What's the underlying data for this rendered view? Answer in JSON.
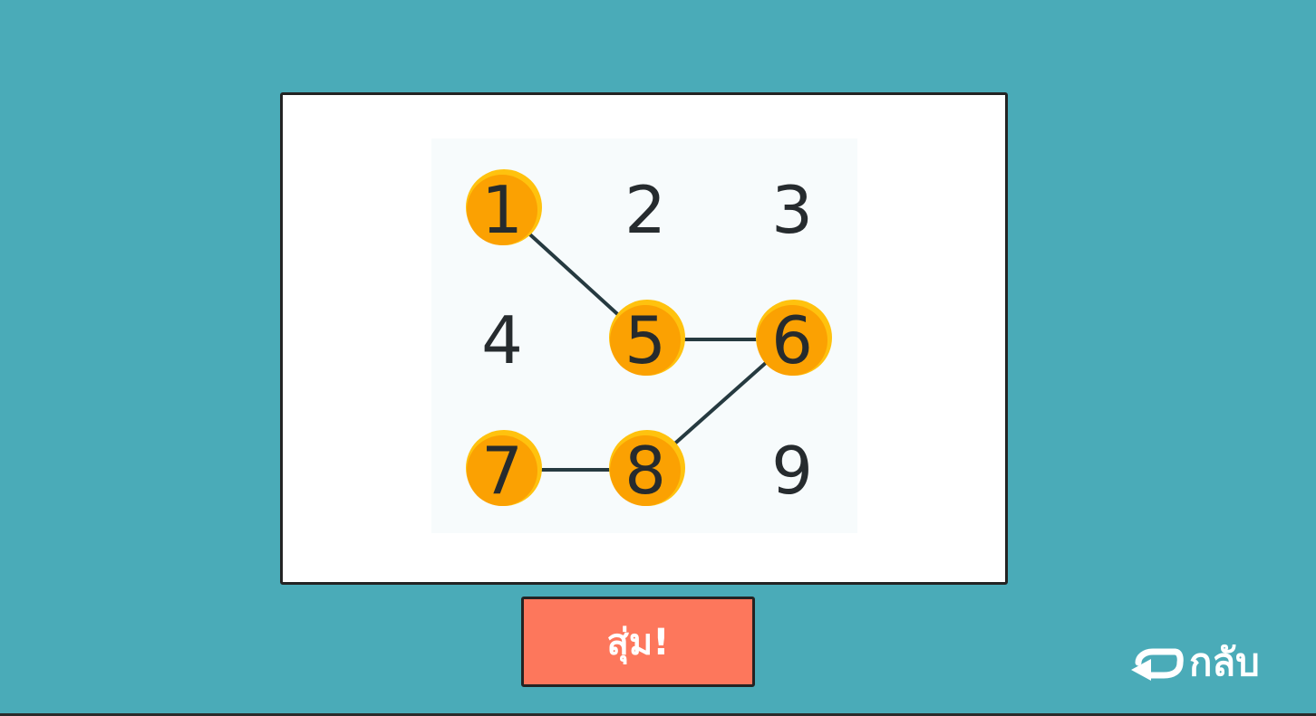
{
  "board": {
    "numbers": [
      "1",
      "2",
      "3",
      "4",
      "5",
      "6",
      "7",
      "8",
      "9"
    ],
    "selected": [
      "1",
      "5",
      "6",
      "7",
      "8"
    ],
    "path": [
      "1",
      "5",
      "6",
      "8",
      "7"
    ]
  },
  "random_button": {
    "label": "สุ่ม!"
  },
  "back_button": {
    "label": "กลับ",
    "icon": "back-arrow-icon"
  },
  "colors": {
    "background": "#4aabb8",
    "board": "#ffffff",
    "circle_fill": "#fba102",
    "circle_rim": "#ffc20e",
    "line": "#263a40",
    "number_ink": "#262b2e",
    "button": "#fd775c",
    "button_text": "#ffffff"
  }
}
